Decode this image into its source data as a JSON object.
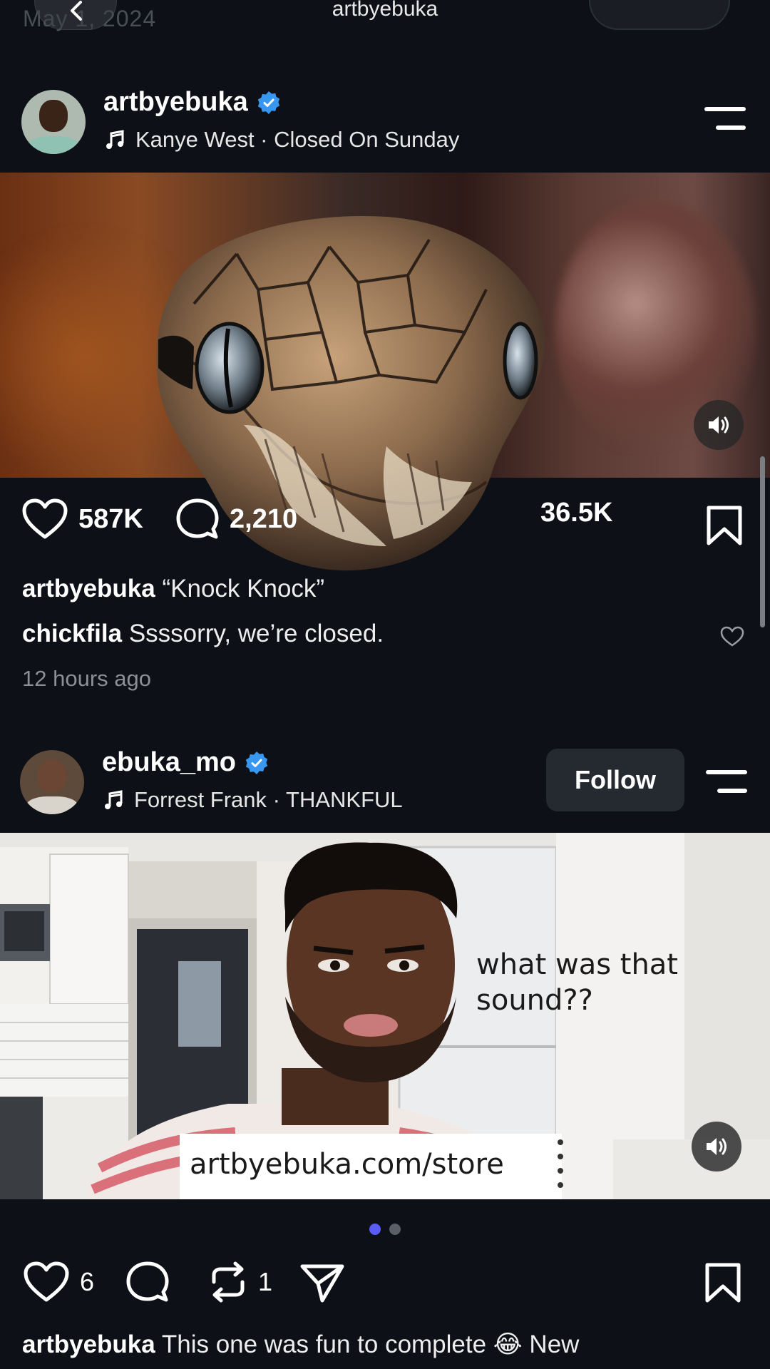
{
  "header": {
    "faded_date": "May 1, 2024",
    "title": "artbyebuka"
  },
  "post1": {
    "username": "artbyebuka",
    "music": "Kanye West · Closed On Sunday",
    "likes": "587K",
    "comments": "2,210",
    "shares": "36.5K",
    "caption_user": "artbyebuka",
    "caption_text": "“Knock Knock”",
    "comment_user": "chickfila",
    "comment_text": "Ssssorry, we’re closed.",
    "time": "12 hours ago"
  },
  "post2": {
    "username": "ebuka_mo",
    "music": "Forrest Frank · THANKFUL",
    "follow_label": "Follow",
    "overlay_text_line1": "what was that",
    "overlay_text_line2": "sound??",
    "store_text": "artbyebuka.com/store",
    "likes": "6",
    "reposts": "1",
    "caption_user": "artbyebuka",
    "caption_text": "This one was fun to complete 😂 New",
    "carousel_dots": 2,
    "carousel_active": 1
  },
  "colors": {
    "background": "#0d1117",
    "verified": "#3897f0",
    "carousel_active": "#5b5cf6",
    "follow_bg": "#252a31"
  },
  "icons": [
    "back-arrow-icon",
    "verified-badge-icon",
    "music-note-icon",
    "menu-icon",
    "sound-on-icon",
    "heart-icon",
    "comment-icon",
    "repost-icon",
    "share-icon",
    "bookmark-icon"
  ]
}
